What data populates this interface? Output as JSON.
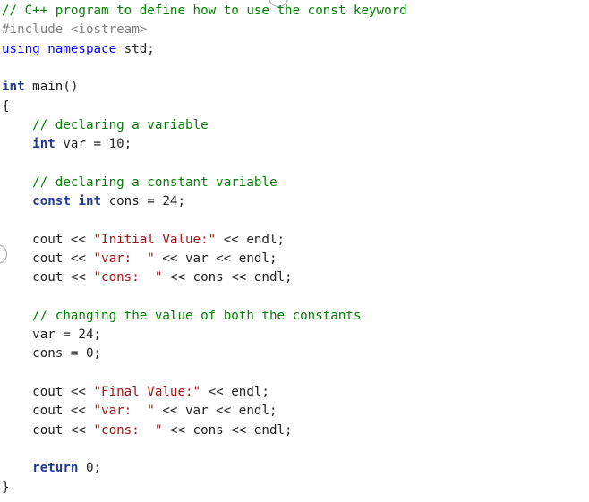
{
  "lines": [
    {
      "tokens": [
        {
          "t": "// C++ program to define how to use the const keyword",
          "c": "comment"
        }
      ]
    },
    {
      "tokens": [
        {
          "t": "#include <iostream>",
          "c": "preproc"
        }
      ]
    },
    {
      "tokens": [
        {
          "t": "using",
          "c": "keyword"
        },
        {
          "t": " ",
          "c": "plain"
        },
        {
          "t": "namespace",
          "c": "keyword"
        },
        {
          "t": " std;",
          "c": "plain"
        }
      ]
    },
    {
      "tokens": []
    },
    {
      "tokens": [
        {
          "t": "int",
          "c": "type"
        },
        {
          "t": " main()",
          "c": "plain"
        }
      ]
    },
    {
      "tokens": [
        {
          "t": "{",
          "c": "plain"
        }
      ]
    },
    {
      "tokens": [
        {
          "t": "    // declaring a variable",
          "c": "comment"
        }
      ]
    },
    {
      "tokens": [
        {
          "t": "    ",
          "c": "plain"
        },
        {
          "t": "int",
          "c": "type"
        },
        {
          "t": " var = 10;",
          "c": "plain"
        }
      ]
    },
    {
      "tokens": []
    },
    {
      "tokens": [
        {
          "t": "    // declaring a constant variable",
          "c": "comment"
        }
      ]
    },
    {
      "tokens": [
        {
          "t": "    ",
          "c": "plain"
        },
        {
          "t": "const",
          "c": "type"
        },
        {
          "t": " ",
          "c": "plain"
        },
        {
          "t": "int",
          "c": "type"
        },
        {
          "t": " cons = 24;",
          "c": "plain"
        }
      ]
    },
    {
      "tokens": []
    },
    {
      "tokens": [
        {
          "t": "    cout << ",
          "c": "plain"
        },
        {
          "t": "\"Initial Value:\"",
          "c": "string"
        },
        {
          "t": " << endl;",
          "c": "plain"
        }
      ]
    },
    {
      "tokens": [
        {
          "t": "    cout << ",
          "c": "plain"
        },
        {
          "t": "\"var:  \"",
          "c": "string"
        },
        {
          "t": " << var << endl;",
          "c": "plain"
        }
      ]
    },
    {
      "tokens": [
        {
          "t": "    cout << ",
          "c": "plain"
        },
        {
          "t": "\"cons:  \"",
          "c": "string"
        },
        {
          "t": " << cons << endl;",
          "c": "plain"
        }
      ]
    },
    {
      "tokens": []
    },
    {
      "tokens": [
        {
          "t": "    // changing the value of both the constants",
          "c": "comment"
        }
      ]
    },
    {
      "tokens": [
        {
          "t": "    var = 24;",
          "c": "plain"
        }
      ]
    },
    {
      "tokens": [
        {
          "t": "    cons = 0;",
          "c": "plain"
        }
      ]
    },
    {
      "tokens": []
    },
    {
      "tokens": [
        {
          "t": "    cout << ",
          "c": "plain"
        },
        {
          "t": "\"Final Value:\"",
          "c": "string"
        },
        {
          "t": " << endl;",
          "c": "plain"
        }
      ]
    },
    {
      "tokens": [
        {
          "t": "    cout << ",
          "c": "plain"
        },
        {
          "t": "\"var:  \"",
          "c": "string"
        },
        {
          "t": " << var << endl;",
          "c": "plain"
        }
      ]
    },
    {
      "tokens": [
        {
          "t": "    cout << ",
          "c": "plain"
        },
        {
          "t": "\"cons:  \"",
          "c": "string"
        },
        {
          "t": " << cons << endl;",
          "c": "plain"
        }
      ]
    },
    {
      "tokens": []
    },
    {
      "tokens": [
        {
          "t": "    ",
          "c": "plain"
        },
        {
          "t": "return",
          "c": "type"
        },
        {
          "t": " 0;",
          "c": "plain"
        }
      ]
    },
    {
      "tokens": [
        {
          "t": "}",
          "c": "plain"
        }
      ]
    }
  ],
  "colors": {
    "comment": "#008000",
    "preproc": "#808080",
    "keyword": "#0000ff",
    "type": "#1f3a93",
    "string": "#a31515",
    "plain": "#1e1e1e"
  }
}
